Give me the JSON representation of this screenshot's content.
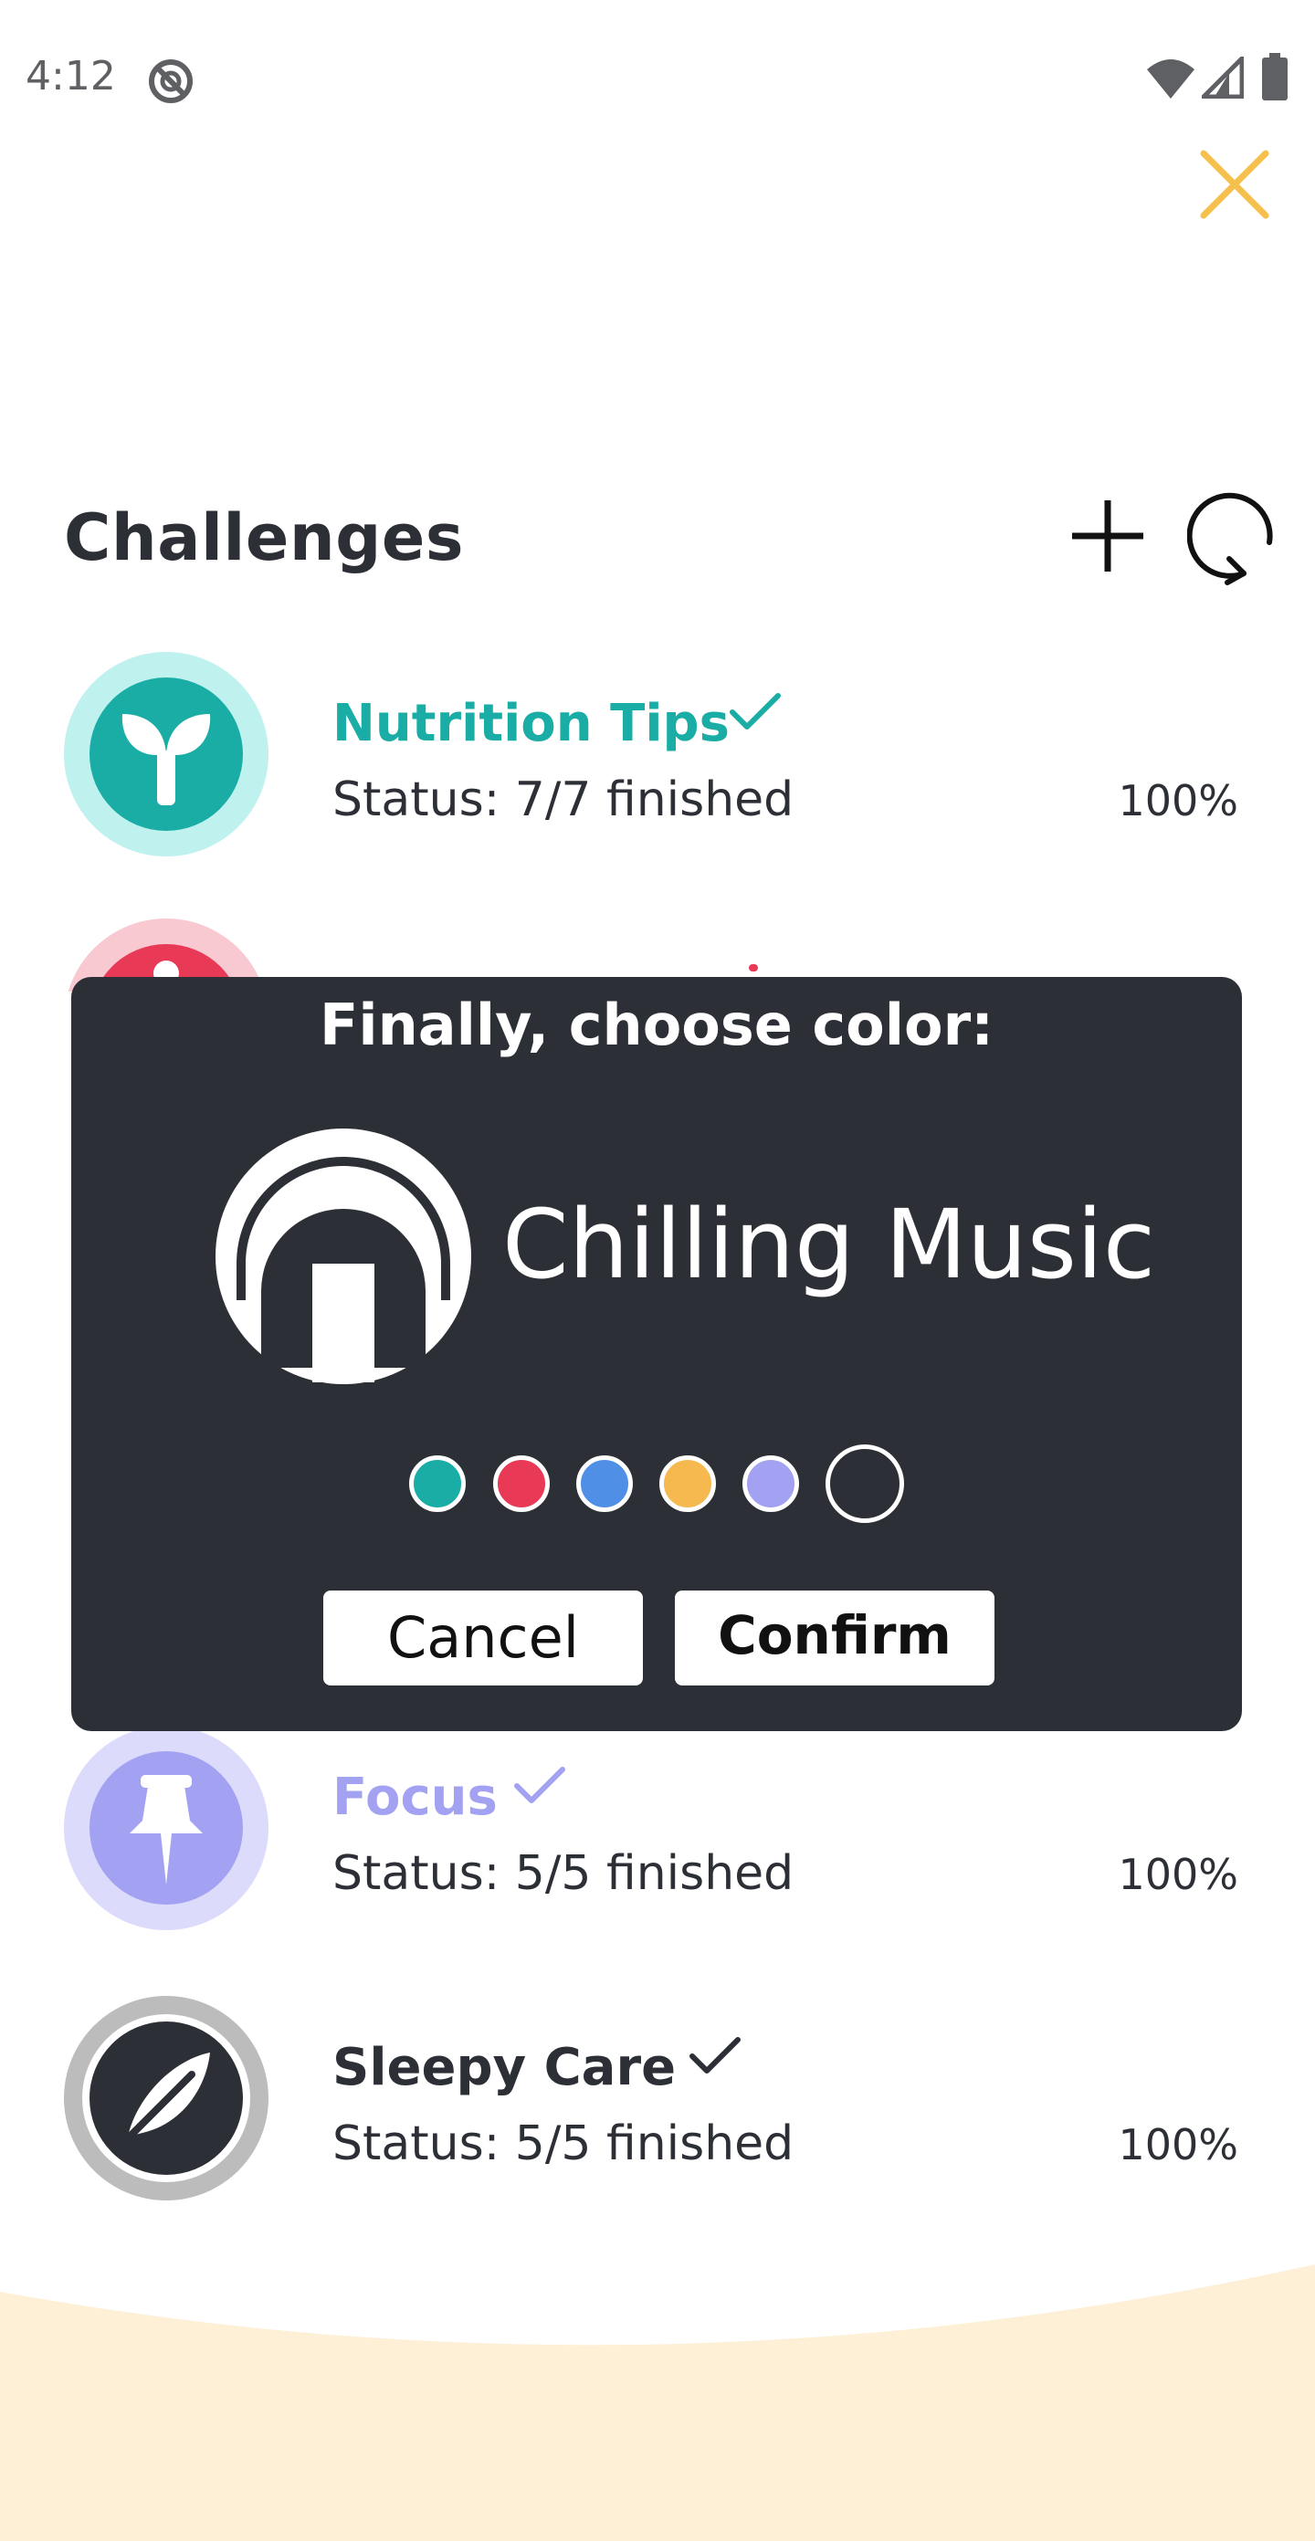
{
  "status_bar": {
    "time": "4:12"
  },
  "header": {
    "title": "Challenges"
  },
  "colors": {
    "teal": "#19ada5",
    "teal_ring": "#bff1ef",
    "red": "#e83a56",
    "red_ring": "#f9c9d1",
    "blue": "#4f8fe6",
    "yellow": "#f6b94f",
    "purple": "#a3a1f2",
    "purple_ring": "#dcdbfb",
    "dark": "#2d2f36",
    "gray_ring": "#bcbcbc",
    "close": "#f6c04e",
    "wave": "#fdf0d7"
  },
  "challenges": [
    {
      "name": "Nutrition Tips",
      "status": "Status: 7/7 finished",
      "percent": "100%",
      "icon": "sprout-icon"
    },
    {
      "name": "Focus",
      "status": "Status: 5/5 finished",
      "percent": "100%",
      "icon": "pushpin-icon"
    },
    {
      "name": "Sleepy Care",
      "status": "Status: 5/5 finished",
      "percent": "100%",
      "icon": "feather-icon"
    }
  ],
  "dialog": {
    "title": "Finally, choose color:",
    "preview_name": "Chilling Music",
    "preview_icon": "headphones-icon",
    "swatches": [
      "teal",
      "red",
      "blue",
      "yellow",
      "purple",
      "none"
    ],
    "cancel_label": "Cancel",
    "confirm_label": "Confirm"
  }
}
